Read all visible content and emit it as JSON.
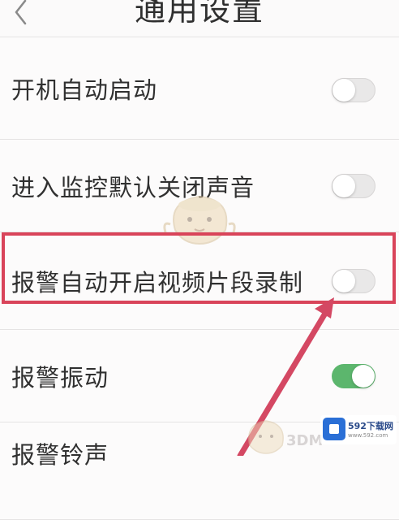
{
  "header": {
    "title": "通用设置",
    "back_icon": "chevron-left-icon"
  },
  "settings": [
    {
      "label": "开机自动启动",
      "enabled": false
    },
    {
      "label": "进入监控默认关闭声音",
      "enabled": false
    },
    {
      "label": "报警自动开启视频片段录制",
      "enabled": false,
      "highlighted": true
    },
    {
      "label": "报警振动",
      "enabled": true
    },
    {
      "label": "报警铃声",
      "enabled": false
    }
  ],
  "colors": {
    "toggle_on": "#5cb66d",
    "toggle_off": "#e9e8e8",
    "highlight": "#d9445a"
  },
  "watermark": {
    "mark": "3DM",
    "site_name": "592下载网",
    "site_sub": "www.592.com"
  }
}
